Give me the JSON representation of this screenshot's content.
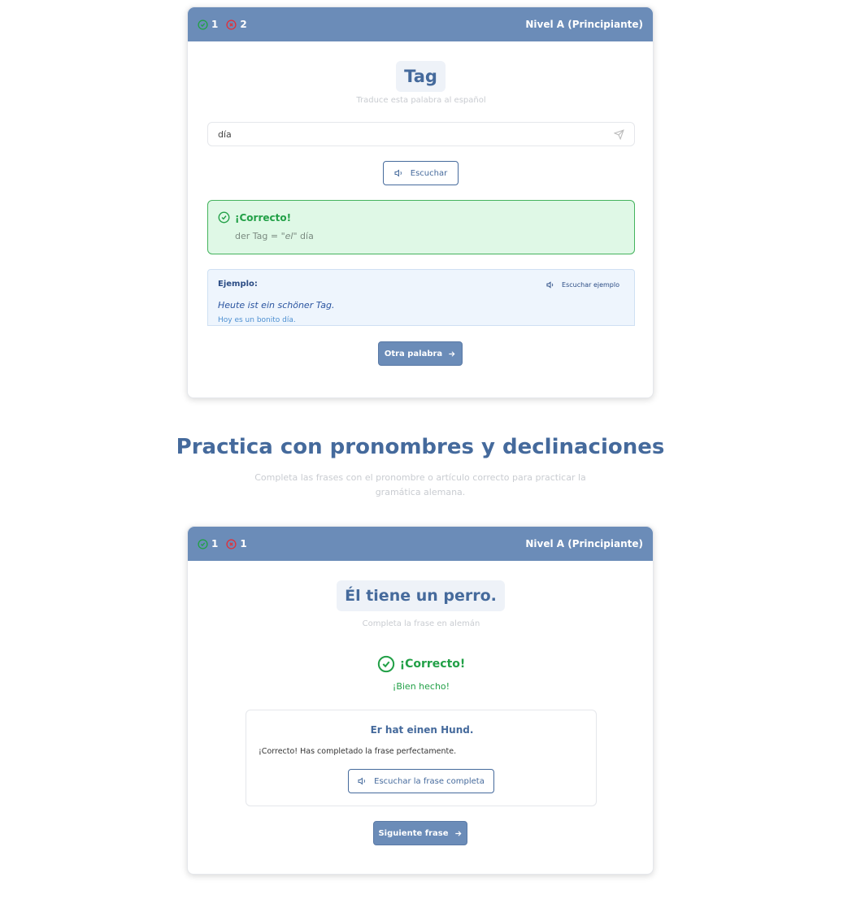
{
  "card1": {
    "score": {
      "correct": "1",
      "wrong": "2"
    },
    "level": "Nivel A (Principiante)",
    "word": "Tag",
    "hint": "Traduce esta palabra al español",
    "input_value": "día",
    "listen_label": "Escuchar",
    "feedback": {
      "title": "¡Correcto!",
      "detail_prefix": "der Tag = ",
      "detail_article": "\"el\"",
      "detail_word": " día"
    },
    "example": {
      "label": "Ejemplo:",
      "listen_label": "Escuchar ejemplo",
      "german": "Heute ist ein schöner Tag.",
      "spanish": "Hoy es un bonito día."
    },
    "next_label": "Otra palabra"
  },
  "section": {
    "title": "Practica con pronombres y declinaciones",
    "subtitle": "Completa las frases con el pronombre o artículo correcto para practicar la gramática alemana."
  },
  "card2": {
    "score": {
      "correct": "1",
      "wrong": "1"
    },
    "level": "Nivel A (Principiante)",
    "sentence": "Él tiene un perro.",
    "hint": "Completa la frase en alemán",
    "feedback_title": "¡Correcto!",
    "feedback_sub": "¡Bien hecho!",
    "answer": "Er hat einen Hund.",
    "message": "¡Correcto! Has completado la frase perfectamente.",
    "listen_label": "Escuchar la frase completa",
    "next_label": "Siguiente frase"
  },
  "colors": {
    "header": "#6b8cb8",
    "accent": "#456a9c",
    "success": "#22a047",
    "error": "#e0313b"
  }
}
